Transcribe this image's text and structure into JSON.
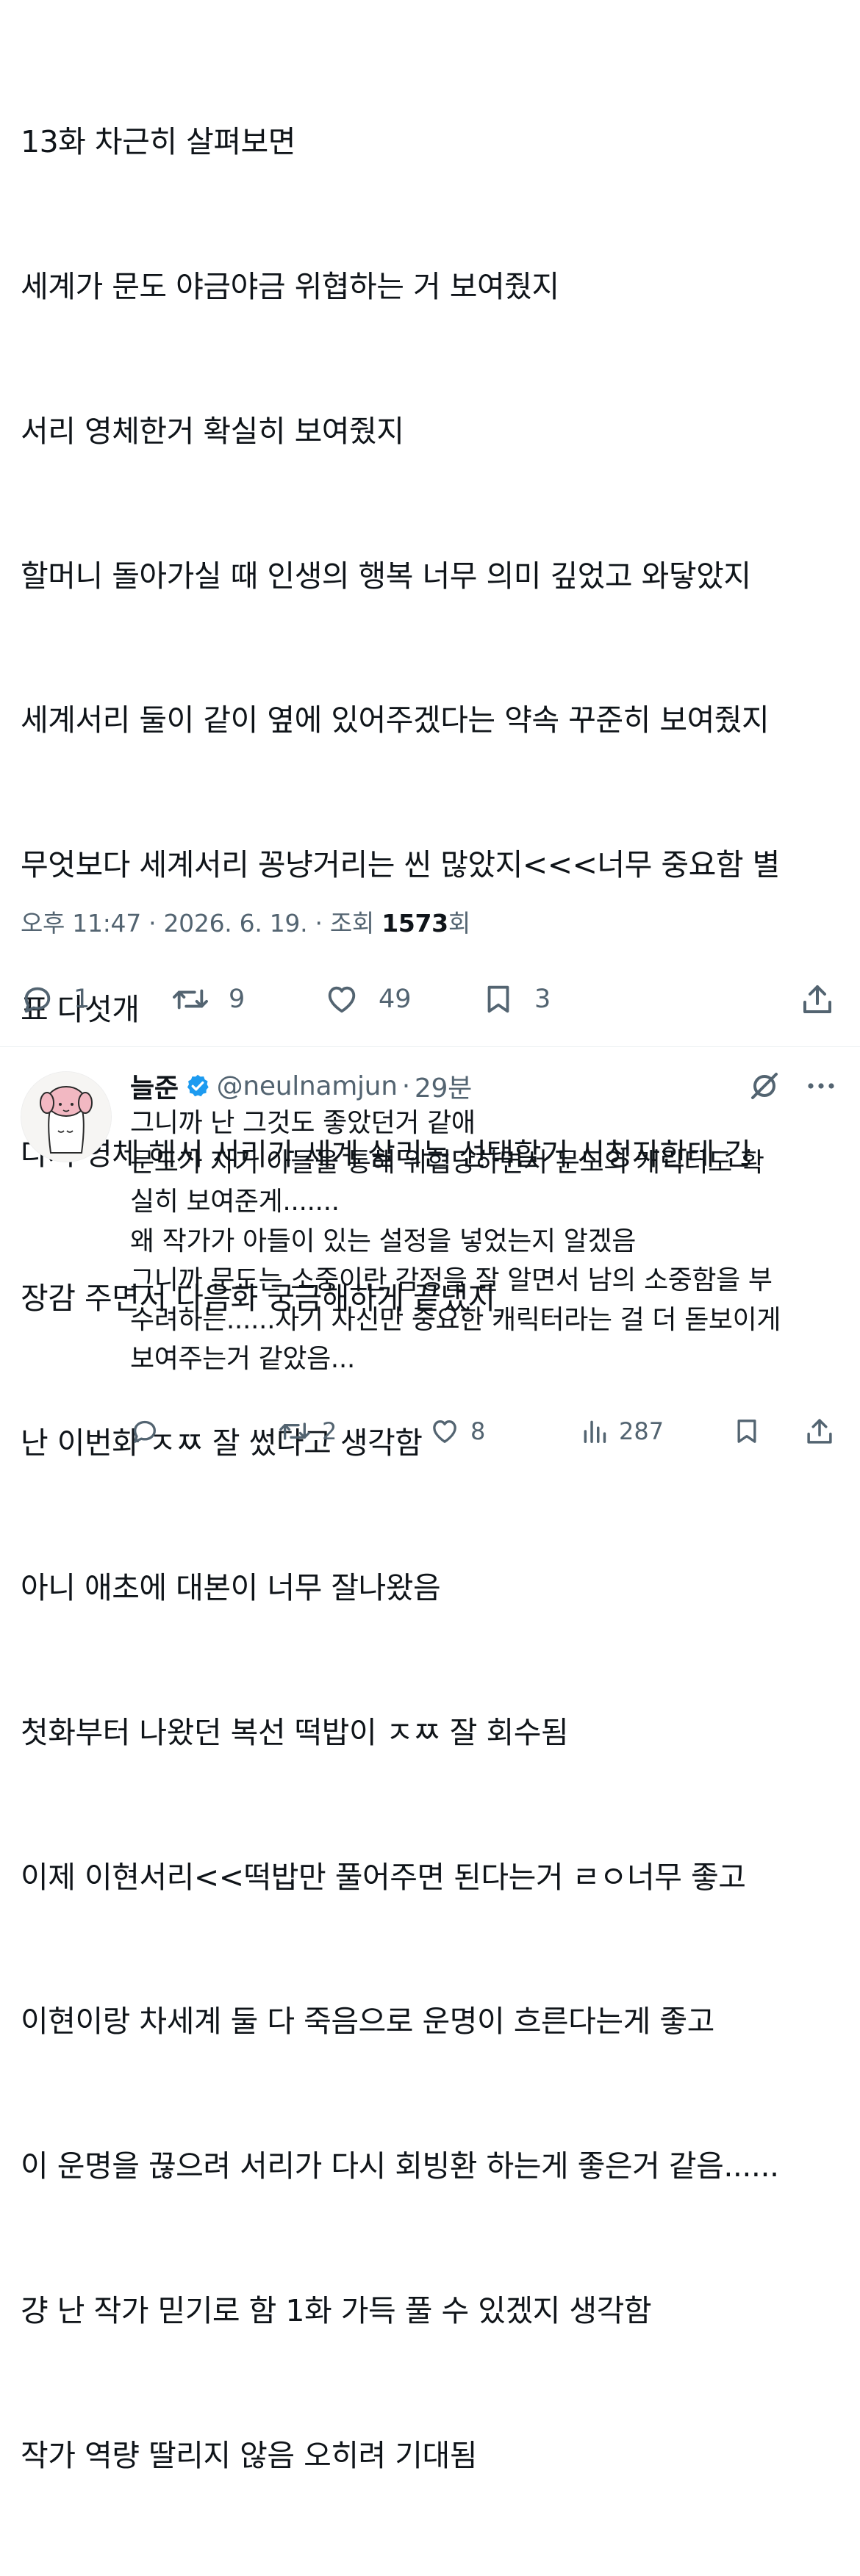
{
  "main_tweet": {
    "lines": [
      "13화 차근히 살펴보면",
      "세계가 문도 야금야금 위협하는 거 보여줬지",
      "서리 영체한거 확실히 보여줬지",
      "할머니 돌아가실 때 인생의 행복 너무 의미 깊었고 와닿았지",
      "세계서리 둘이 같이 옆에 있어주겠다는 약속 꾸준히 보여줬지",
      "무엇보다 세계서리 꽁냥거리는 씬 많았지<<<너무 중요함 별",
      "표 다섯개",
      "다시 영체 해서 서리가 세계 살리는 선택할거 시청자한테 긴",
      "장감 주면서 다음화 궁금해하게 끝냈지",
      "난 이번화 ㅈㅉ 잘 썼다고 생각함",
      "아니 애초에 대본이 너무 잘나왔음",
      "첫화부터 나왔던 복선 떡밥이 ㅈㅉ 잘 회수됨",
      "이제 이현서리<<떡밥만 풀어주면 된다는거 ㄹㅇ너무 좋고",
      "이현이랑 차세계 둘 다 죽음으로 운명이 흐른다는게 좋고",
      "이 운명을 끊으려 서리가 다시 회빙환 하는게 좋은거 같음......",
      "걍 난 작가 믿기로 함 1화 가득 풀 수 있겠지 생각함",
      "작가 역량 딸리지 않음 오히려 기대됨"
    ],
    "meta": {
      "prefix": "오후 11:47 · 2026. 6. 19. · 조회 ",
      "views": "1573",
      "suffix": "회"
    },
    "actions": {
      "replies": "1",
      "retweets": "9",
      "likes": "49",
      "bookmarks": "3"
    }
  },
  "reply": {
    "name": "늘준",
    "handle": "@neulnamjun",
    "separator": "·",
    "time": "29분",
    "lines": [
      "그니까 난 그것도 좋았던거 같애",
      "문도가 자기 아들을 통해 위협당하면서 문도의 캐릭터도 확",
      "실히 보여준게.......",
      "왜 작가가 아들이 있는 설정을 넣었는지 알겠음",
      "그니까 문도는 소중이란 감정을 잘 알면서 남의 소중함을 부",
      "수려하는......자기 자신만 중요한 캐릭터라는 걸 더 돋보이게",
      "보여주는거 같았음..."
    ],
    "actions": {
      "replies": "",
      "retweets": "2",
      "likes": "8",
      "views": "287"
    }
  },
  "colors": {
    "text": "#0f1419",
    "secondary": "#536471",
    "verified": "#1d9bf0",
    "divider": "#eff3f4"
  },
  "icons": [
    "reply-icon",
    "retweet-icon",
    "like-icon",
    "bookmark-icon",
    "share-icon",
    "verified-badge-icon",
    "grok-icon",
    "more-icon",
    "views-icon"
  ]
}
